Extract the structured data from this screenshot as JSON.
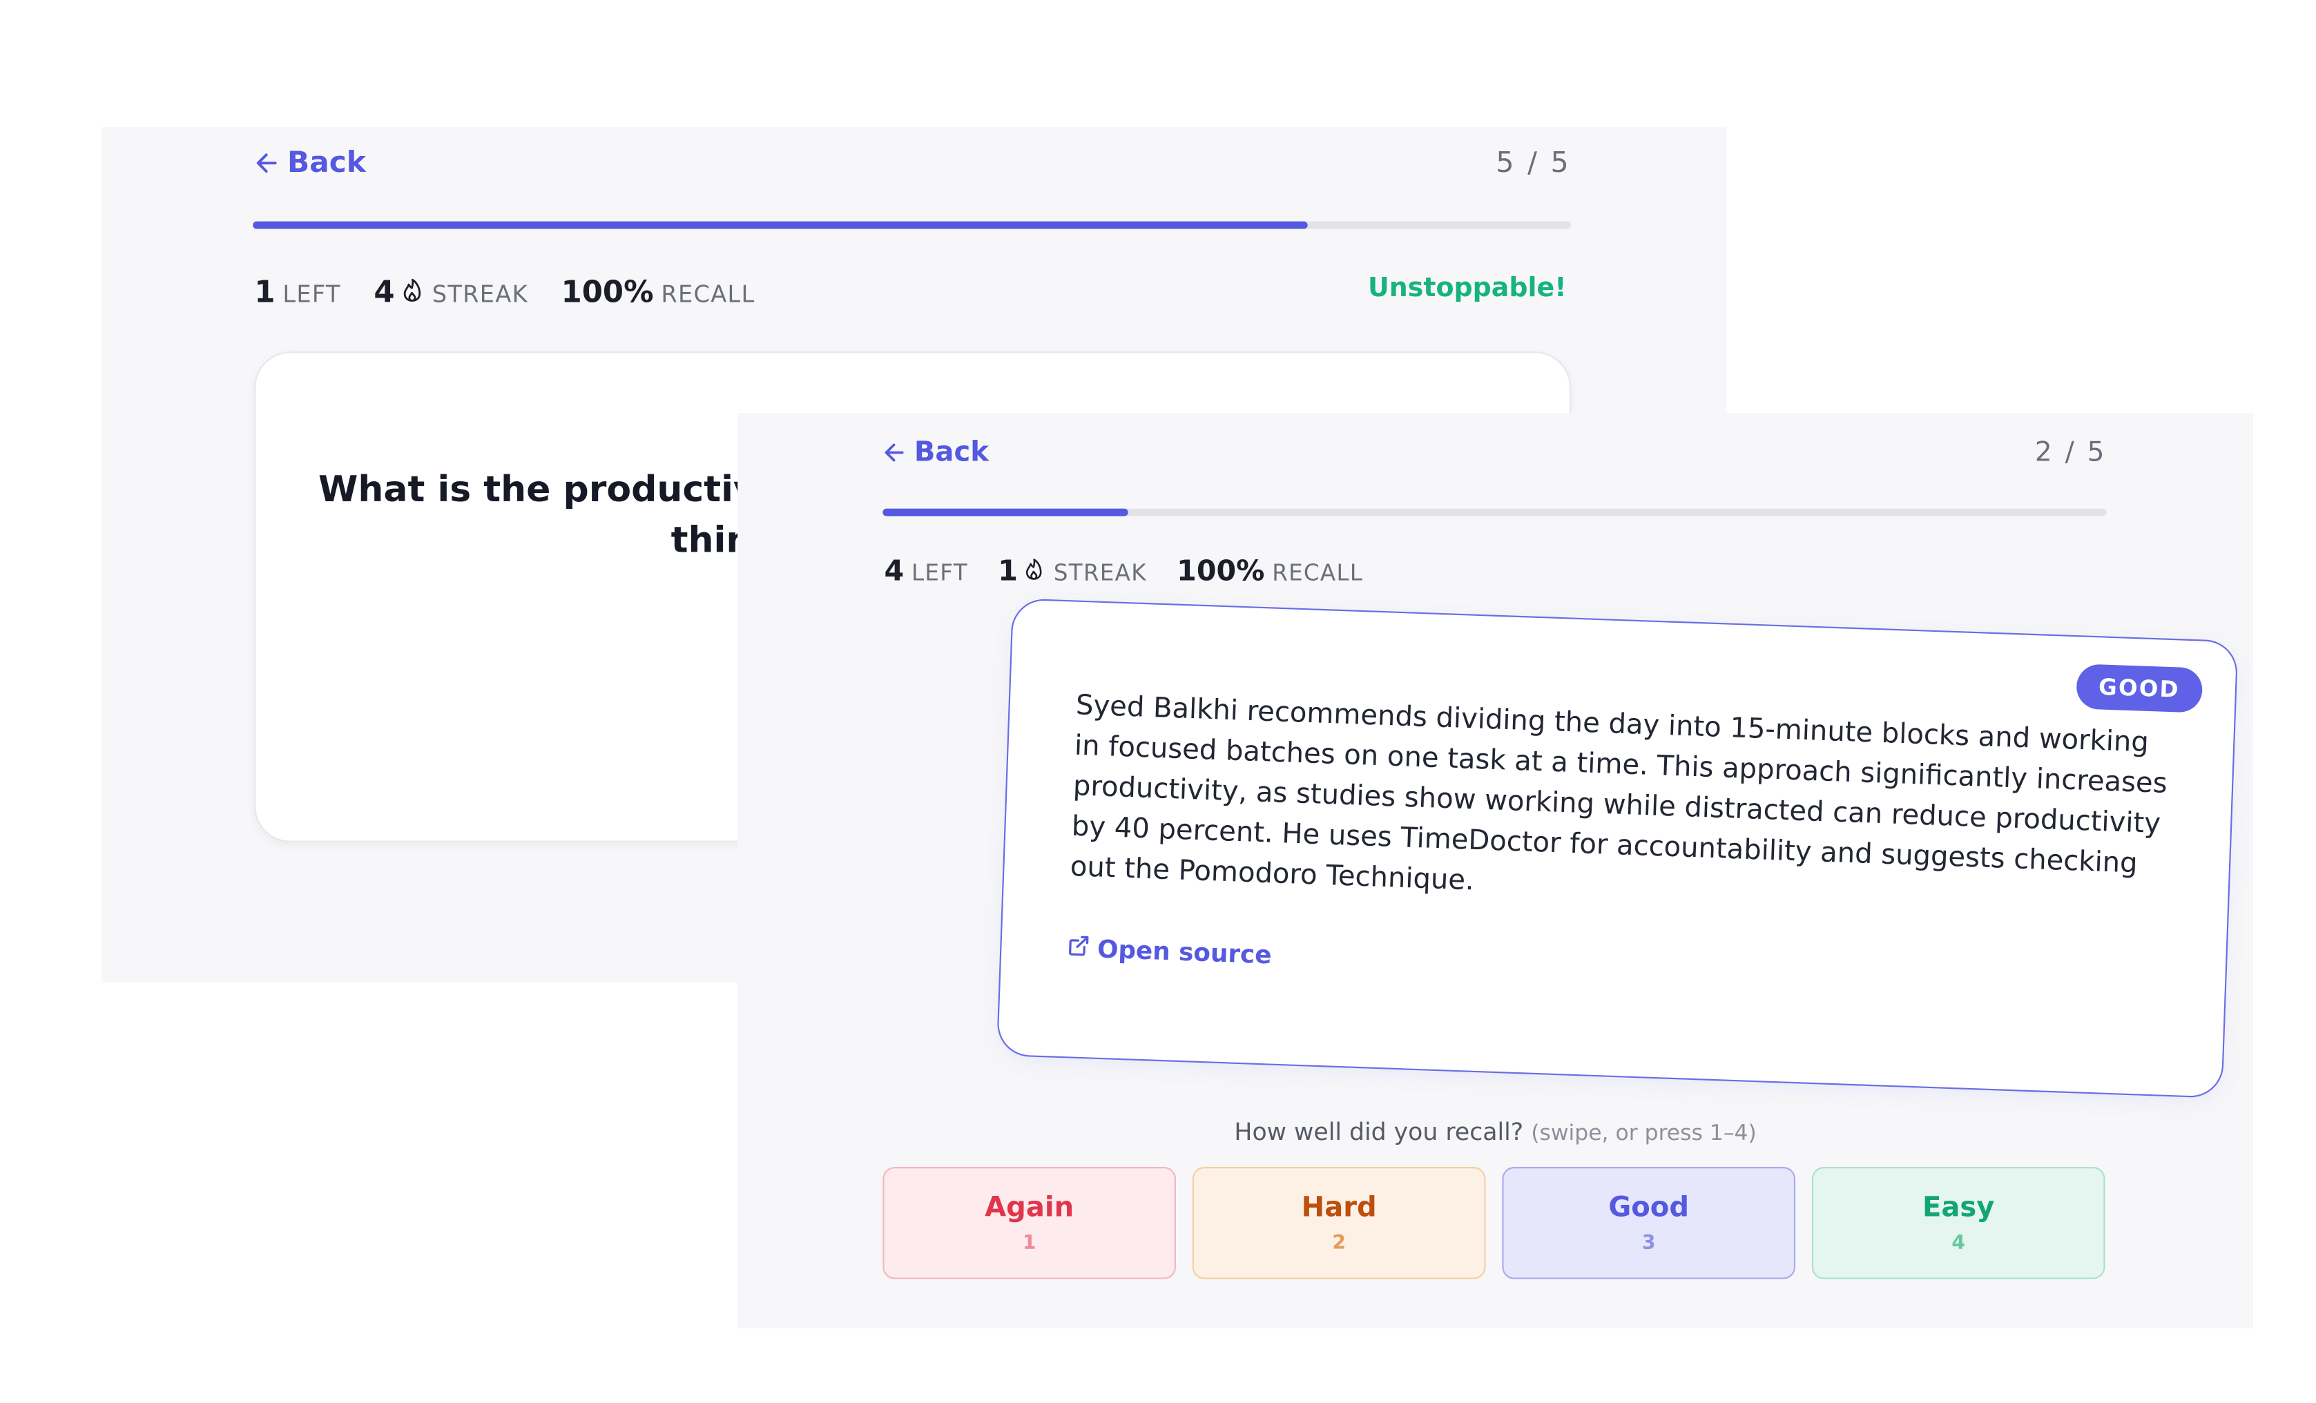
{
  "screen1": {
    "back_label": "Back",
    "counter": "5 / 5",
    "progress_fraction": 0.8,
    "stats": {
      "left_num": "1",
      "left_label": "LEFT",
      "streak_num": "4",
      "streak_label": "STREAK",
      "recall_num": "100%",
      "recall_label": "RECALL"
    },
    "cheer": "Unstoppable!",
    "question": "What is the productivity tip about eating a live frog first thing in the morning?"
  },
  "screen2": {
    "back_label": "Back",
    "counter": "2 / 5",
    "progress_fraction": 0.2,
    "stats": {
      "left_num": "4",
      "left_label": "LEFT",
      "streak_num": "1",
      "streak_label": "STREAK",
      "recall_num": "100%",
      "recall_label": "RECALL"
    },
    "badge": "GOOD",
    "answer": "Syed Balkhi recommends dividing the day into 15-minute blocks and working in focused batches on one task at a time. This approach significantly increases productivity, as studies show working while distracted can reduce productivity by 40 percent. He uses TimeDoctor for accountability and suggests checking out the Pomodoro Technique.",
    "open_source_label": "Open source",
    "prompt": "How well did you recall?",
    "prompt_hint": "(swipe, or press 1–4)",
    "ratings": [
      {
        "label": "Again",
        "key": "1"
      },
      {
        "label": "Hard",
        "key": "2"
      },
      {
        "label": "Good",
        "key": "3"
      },
      {
        "label": "Easy",
        "key": "4"
      }
    ]
  },
  "colors": {
    "accent": "#5558e0",
    "success": "#16b37e",
    "again": "#e0364b",
    "hard": "#bd4f0e",
    "easy": "#12a673"
  }
}
